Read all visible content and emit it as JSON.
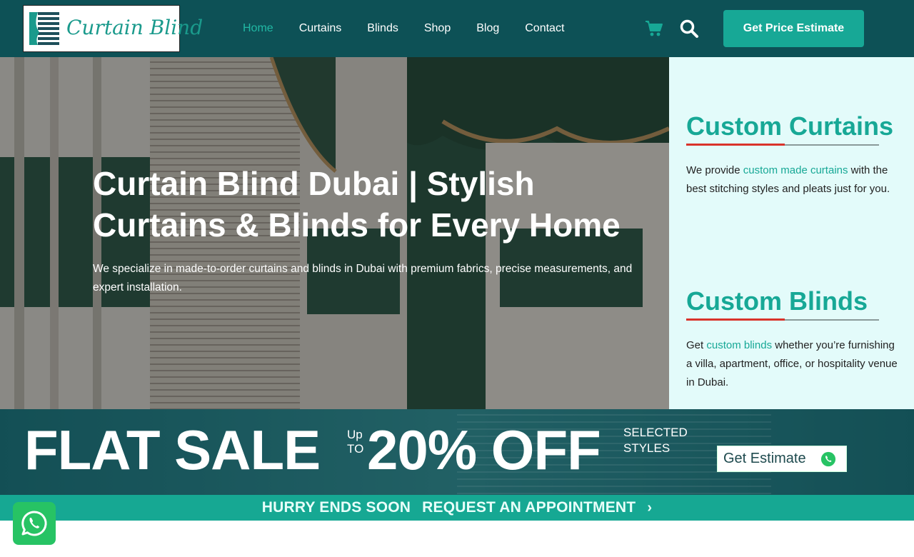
{
  "header": {
    "logo_text": "Curtain Blind",
    "nav": [
      {
        "label": "Home",
        "active": true
      },
      {
        "label": "Curtains"
      },
      {
        "label": "Blinds"
      },
      {
        "label": "Shop"
      },
      {
        "label": "Blog"
      },
      {
        "label": "Contact"
      }
    ],
    "cart_icon": "cart-icon",
    "search_icon": "search-icon",
    "cta_label": "Get Price Estimate"
  },
  "hero": {
    "title": "Curtain Blind Dubai | Stylish Curtains & Blinds for Every Home",
    "subtitle": "We specialize in made-to-order curtains and blinds in Dubai with premium fabrics, precise measurements, and expert installation."
  },
  "side": {
    "curtains": {
      "heading": "Custom Curtains",
      "text_before": "We provide ",
      "link": "custom made curtains",
      "text_after": " with the best stitching styles and pleats just for you."
    },
    "blinds": {
      "heading": "Custom Blinds",
      "text_before": "Get ",
      "link": "custom blinds",
      "text_after": " whether you’re furnishing a villa, apartment, office, or hospitality venue in Dubai."
    }
  },
  "sale": {
    "flat": "FLAT SALE",
    "up": "Up",
    "to": "TO",
    "percent": "20% OFF",
    "selected": "SELECTED",
    "styles": "STYLES",
    "button_label": "Get Estimate"
  },
  "hurry": {
    "left": "HURRY ENDS SOON",
    "right": "REQUEST AN APPOINTMENT",
    "chevron": "›"
  },
  "colors": {
    "header_bg": "#0d5156",
    "accent": "#17a896",
    "side_bg": "#e3fbfa",
    "underline_red": "#d9332b",
    "whatsapp": "#27c364"
  }
}
